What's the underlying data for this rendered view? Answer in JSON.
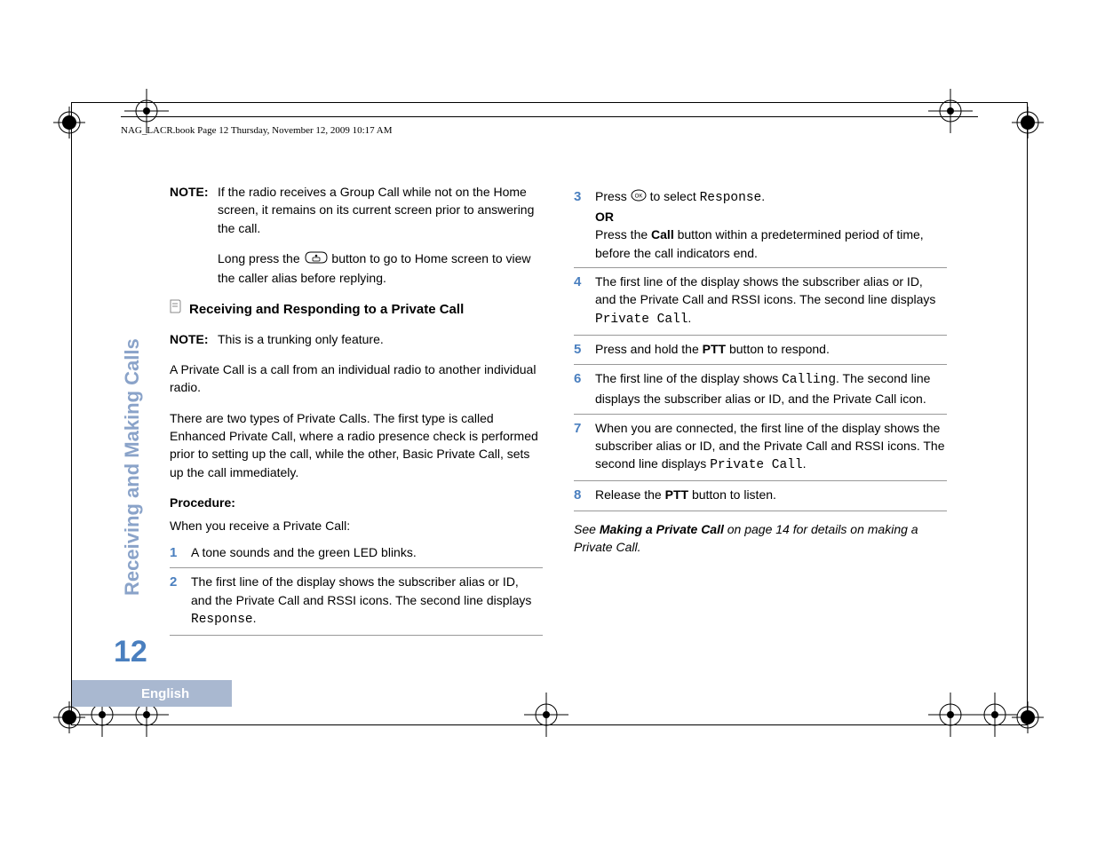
{
  "header": "NAG_LACR.book  Page 12  Thursday, November 12, 2009  10:17 AM",
  "side_title": "Receiving and Making Calls",
  "page_number": "12",
  "language": "English",
  "left": {
    "note1_label": "NOTE:",
    "note1_text": "If the radio receives a Group Call while not on the Home screen, it remains on its current screen prior to answering the call.",
    "longpress_pre": "Long press the ",
    "longpress_post": " button to go to Home screen to view the caller alias before replying.",
    "heading": "Receiving and Responding to a Private Call",
    "note2_label": "NOTE:",
    "note2_text": "This is a trunking only feature.",
    "p1": "A Private Call is a call from an individual radio to another individual radio.",
    "p2": "There are two types of Private Calls. The first type is called Enhanced Private Call, where a radio presence check is performed prior to setting up the call, while the other, Basic Private Call, sets up the call immediately.",
    "procedure": "Procedure:",
    "proc_intro": "When you receive a Private Call:",
    "s1n": "1",
    "s1": "A tone sounds and the green LED blinks.",
    "s2n": "2",
    "s2_pre": "The first line of the display shows the subscriber alias or ID, and the Private Call and RSSI icons. The second line displays ",
    "s2_mono": "Response",
    "s2_post": "."
  },
  "right": {
    "s3n": "3",
    "s3_pre": "Press ",
    "s3_post": " to select ",
    "s3_mono": "Response",
    "s3_end": ".",
    "s3_or": "OR",
    "s3_b_pre": "Press the ",
    "s3_b_bold": "Call",
    "s3_b_post": " button within a predetermined period of time, before the call indicators end.",
    "s4n": "4",
    "s4_pre": "The first line of the display shows the subscriber alias or ID, and the Private Call and RSSI icons. The second line displays ",
    "s4_mono": "Private Call",
    "s4_post": ".",
    "s5n": "5",
    "s5_pre": "Press and hold the ",
    "s5_bold": "PTT",
    "s5_post": " button to respond.",
    "s6n": "6",
    "s6_pre": "The first line of the display shows ",
    "s6_mono": "Calling",
    "s6_post": ". The second line displays the subscriber alias or ID, and the Private Call icon.",
    "s7n": "7",
    "s7_pre": "When you are connected, the first line of the display shows the subscriber alias or ID, and the Private Call and RSSI icons. The second line displays ",
    "s7_mono": "Private Call",
    "s7_post": ".",
    "s8n": "8",
    "s8_pre": " Release the ",
    "s8_bold": "PTT",
    "s8_post": " button to listen.",
    "footer_pre": "See ",
    "footer_bold": "Making a Private Call",
    "footer_post": " on page 14 for details on making a Private Call."
  }
}
